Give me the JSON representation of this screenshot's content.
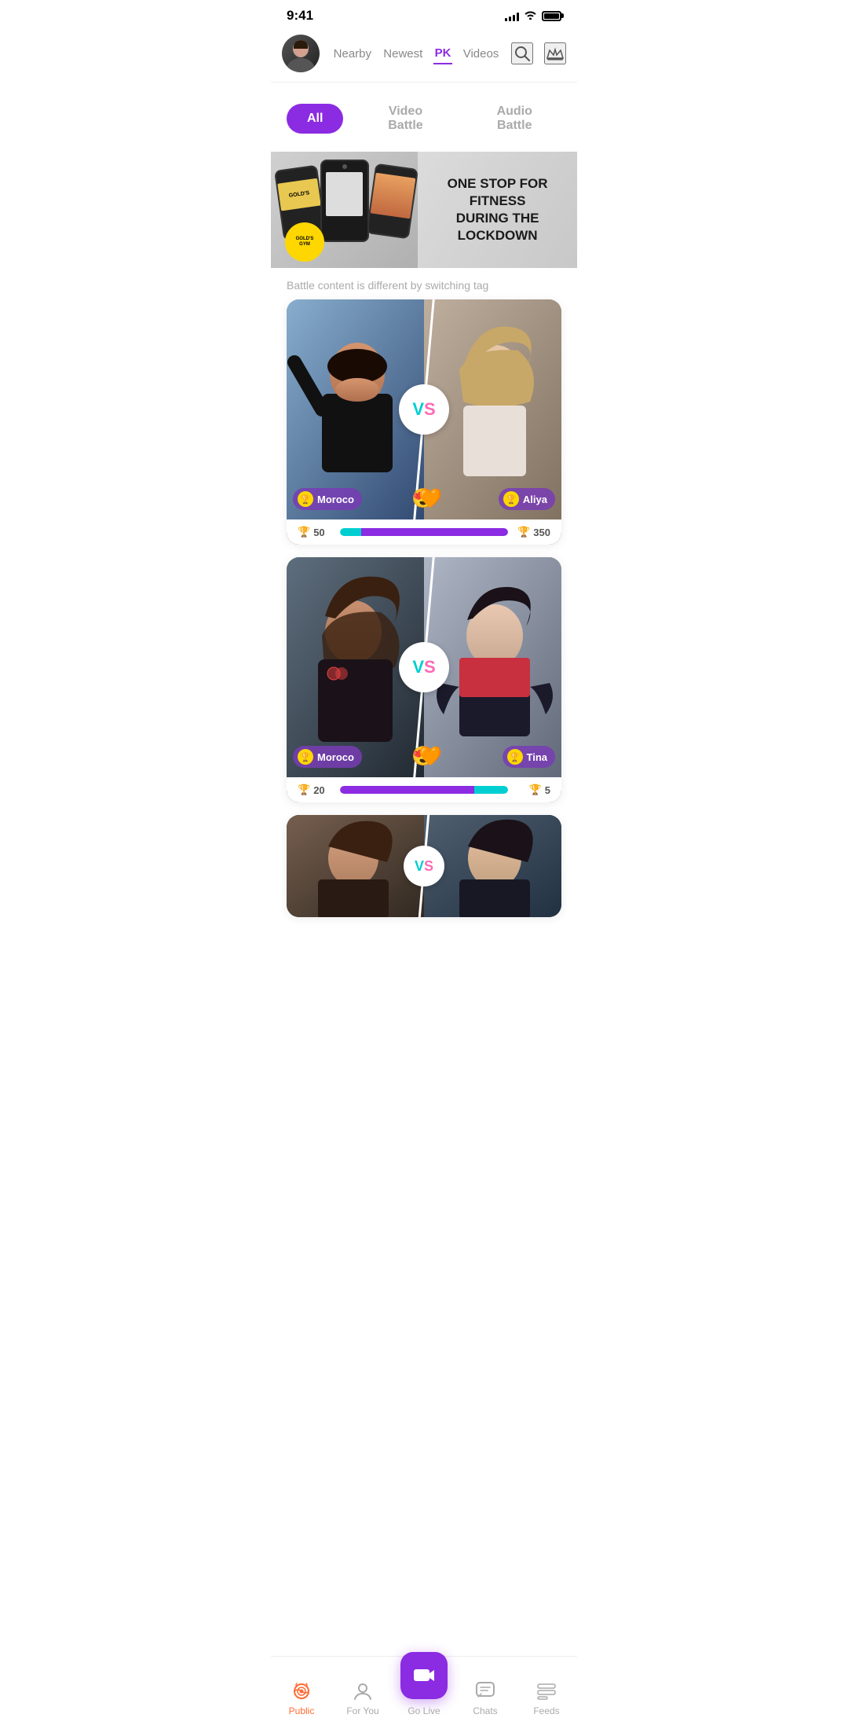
{
  "status": {
    "time": "9:41",
    "signal": [
      4,
      6,
      8,
      10,
      12
    ],
    "wifi": true,
    "battery": 90
  },
  "header": {
    "tabs": [
      {
        "id": "nearby",
        "label": "Nearby",
        "active": false
      },
      {
        "id": "newest",
        "label": "Newest",
        "active": false
      },
      {
        "id": "pk",
        "label": "PK",
        "active": true
      },
      {
        "id": "videos",
        "label": "Videos",
        "active": false
      }
    ]
  },
  "filter": {
    "options": [
      "All",
      "Video Battle",
      "Audio Battle"
    ],
    "active": "All"
  },
  "banner": {
    "text_line1": "ONE STOP FOR FITNESS",
    "text_line2": "DURING THE LOCKDOWN"
  },
  "subtitle": "Battle content is different by switching tag",
  "battles": [
    {
      "id": 1,
      "player1": {
        "name": "Moroco",
        "score": 50
      },
      "player2": {
        "name": "Aliya",
        "score": 350
      },
      "emoji1": "😍",
      "emoji2": "🧡"
    },
    {
      "id": 2,
      "player1": {
        "name": "Moroco",
        "score": 20
      },
      "player2": {
        "name": "Tina",
        "score": 5
      },
      "emoji1": "😍",
      "emoji2": "🧡"
    }
  ],
  "vs": {
    "v": "V",
    "s": "S"
  },
  "bottomNav": {
    "items": [
      {
        "id": "public",
        "label": "Public",
        "active": true
      },
      {
        "id": "foryou",
        "label": "For You",
        "active": false
      },
      {
        "id": "golive",
        "label": "Go Live",
        "active": false
      },
      {
        "id": "chats",
        "label": "Chats",
        "active": false
      },
      {
        "id": "feeds",
        "label": "Feeds",
        "active": false
      }
    ]
  }
}
